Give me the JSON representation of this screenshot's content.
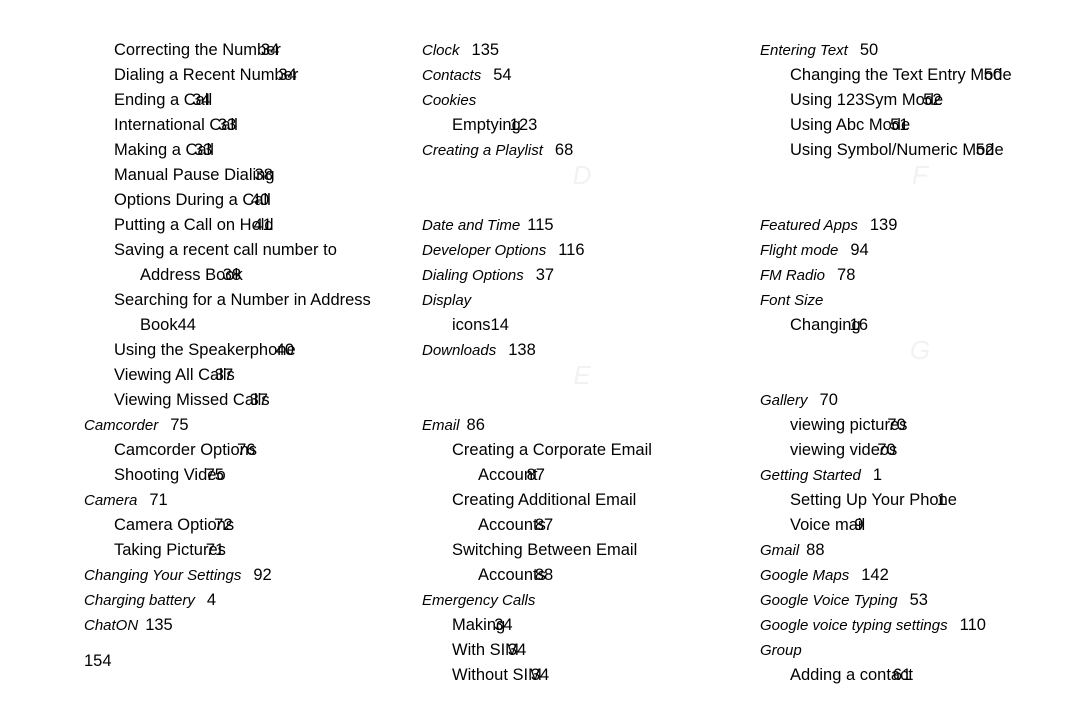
{
  "document": {
    "type": "index-page",
    "folio": "154",
    "background_color": "#ffffff",
    "text_color": "#000000",
    "section_letter_color": "#f2f2f2"
  },
  "columns": [
    {
      "id": "column-1",
      "rows": [
        {
          "kind": "sub",
          "text": "Correcting the Number",
          "page": "34",
          "overlap": "ov2"
        },
        {
          "kind": "sub",
          "text": "Dialing a Recent Number",
          "page": "34",
          "overlap": "ov2"
        },
        {
          "kind": "sub",
          "text": "Ending a Call",
          "page": "34",
          "overlap": "ov2"
        },
        {
          "kind": "sub",
          "text": "International Call",
          "page": "33",
          "overlap": "ov2"
        },
        {
          "kind": "sub",
          "text": "Making a Call",
          "page": "33",
          "overlap": "ov2"
        },
        {
          "kind": "sub",
          "text": "Manual Pause Dialing",
          "page": "38",
          "overlap": "ov2"
        },
        {
          "kind": "sub",
          "text": "Options During a Call",
          "page": "40",
          "overlap": "ov2"
        },
        {
          "kind": "sub",
          "text": "Putting a Call on Hold",
          "page": "41",
          "overlap": "ov2"
        },
        {
          "kind": "sub",
          "text": "Saving a recent call number to",
          "page": "",
          "overlap": "ov0"
        },
        {
          "kind": "sub2",
          "text": "Address Book",
          "page": "38",
          "overlap": "ov2"
        },
        {
          "kind": "sub",
          "text": "Searching for a Number in Address",
          "page": "",
          "overlap": "ov0"
        },
        {
          "kind": "sub2",
          "text": "Book",
          "page": "44",
          "overlap": "ov0"
        },
        {
          "kind": "sub",
          "text": "Using the Speakerphone",
          "page": "40",
          "overlap": "ov2"
        },
        {
          "kind": "sub",
          "text": "Viewing All Calls",
          "page": "37",
          "overlap": "ov2"
        },
        {
          "kind": "sub",
          "text": "Viewing Missed Calls",
          "page": "37",
          "overlap": "ov2"
        },
        {
          "kind": "head",
          "text": "Camcorder",
          "page": "75",
          "overlap": "gap2"
        },
        {
          "kind": "sub",
          "text": "Camcorder Options",
          "page": "76",
          "overlap": "ov2"
        },
        {
          "kind": "sub",
          "text": "Shooting Video",
          "page": "75",
          "overlap": "ov2"
        },
        {
          "kind": "head",
          "text": "Camera",
          "page": "71",
          "overlap": "gap2"
        },
        {
          "kind": "sub",
          "text": "Camera Options",
          "page": "72",
          "overlap": "ov2"
        },
        {
          "kind": "sub",
          "text": "Taking Pictures",
          "page": "71",
          "overlap": "ov2"
        },
        {
          "kind": "head",
          "text": "Changing Your Settings",
          "page": "92",
          "overlap": "gap2"
        },
        {
          "kind": "head",
          "text": "Charging battery",
          "page": "4",
          "overlap": "gap2"
        },
        {
          "kind": "head",
          "text": "ChatON",
          "page": "135",
          "overlap": "gap"
        }
      ]
    },
    {
      "id": "column-2",
      "rows": [
        {
          "kind": "head",
          "text": "Clock",
          "page": "135",
          "overlap": "gap2"
        },
        {
          "kind": "head",
          "text": "Contacts",
          "page": "54",
          "overlap": "gap2"
        },
        {
          "kind": "head",
          "text": "Cookies",
          "page": "",
          "overlap": "ov0"
        },
        {
          "kind": "sub",
          "text": "Emptying",
          "page": "123",
          "overlap": "ov1"
        },
        {
          "kind": "head",
          "text": "Creating a Playlist",
          "page": "68",
          "overlap": "gap2"
        },
        {
          "kind": "letter",
          "text": "D"
        },
        {
          "kind": "spacer"
        },
        {
          "kind": "head",
          "text": "Date and Time",
          "page": "115",
          "overlap": "gap"
        },
        {
          "kind": "head",
          "text": "Developer Options",
          "page": "116",
          "overlap": "gap2"
        },
        {
          "kind": "head",
          "text": "Dialing Options",
          "page": "37",
          "overlap": "gap2"
        },
        {
          "kind": "head",
          "text": "Display",
          "page": "",
          "overlap": "ov0"
        },
        {
          "kind": "sub",
          "text": "icons",
          "page": "14",
          "overlap": "ov0"
        },
        {
          "kind": "head",
          "text": "Downloads",
          "page": "138",
          "overlap": "gap2"
        },
        {
          "kind": "letter",
          "text": "E"
        },
        {
          "kind": "spacer"
        },
        {
          "kind": "head",
          "text": "Email",
          "page": "86",
          "overlap": "gap"
        },
        {
          "kind": "sub",
          "text": "Creating a Corporate Email",
          "page": "",
          "overlap": "ov0"
        },
        {
          "kind": "sub2",
          "text": "Account",
          "page": "87",
          "overlap": "ov1"
        },
        {
          "kind": "sub",
          "text": "Creating Additional Email",
          "page": "",
          "overlap": "ov0"
        },
        {
          "kind": "sub2",
          "text": "Accounts",
          "page": "87",
          "overlap": "ov1"
        },
        {
          "kind": "sub",
          "text": "Switching Between Email",
          "page": "",
          "overlap": "ov0"
        },
        {
          "kind": "sub2",
          "text": "Accounts",
          "page": "88",
          "overlap": "ov1"
        },
        {
          "kind": "head",
          "text": "Emergency Calls",
          "page": "",
          "overlap": "ov0"
        },
        {
          "kind": "sub",
          "text": "Making",
          "page": "34",
          "overlap": "ov1"
        },
        {
          "kind": "sub",
          "text": "With SIM",
          "page": "34",
          "overlap": "ov1"
        },
        {
          "kind": "sub",
          "text": "Without SIM",
          "page": "34",
          "overlap": "ov1"
        }
      ]
    },
    {
      "id": "column-3",
      "rows": [
        {
          "kind": "head",
          "text": "Entering Text",
          "page": "50",
          "overlap": "gap2"
        },
        {
          "kind": "sub",
          "text": "Changing the Text Entry Mode",
          "page": "50",
          "overlap": "ov3"
        },
        {
          "kind": "sub",
          "text": "Using 123Sym Mode",
          "page": "52",
          "overlap": "ov2"
        },
        {
          "kind": "sub",
          "text": "Using Abc Mode",
          "page": "51",
          "overlap": "ov2"
        },
        {
          "kind": "sub",
          "text": "Using Symbol/Numeric Mode",
          "page": "52",
          "overlap": "ov3"
        },
        {
          "kind": "letter",
          "text": "F"
        },
        {
          "kind": "spacer"
        },
        {
          "kind": "head",
          "text": "Featured Apps",
          "page": "139",
          "overlap": "gap2"
        },
        {
          "kind": "head",
          "text": "Flight mode",
          "page": "94",
          "overlap": "gap2"
        },
        {
          "kind": "head",
          "text": "FM Radio",
          "page": "78",
          "overlap": "gap2"
        },
        {
          "kind": "head",
          "text": "Font Size",
          "page": "",
          "overlap": "ov0"
        },
        {
          "kind": "sub",
          "text": "Changing",
          "page": "16",
          "overlap": "ov1"
        },
        {
          "kind": "letter",
          "text": "G"
        },
        {
          "kind": "spacer"
        },
        {
          "kind": "head",
          "text": "Gallery",
          "page": "70",
          "overlap": "gap2"
        },
        {
          "kind": "sub",
          "text": "viewing pictures",
          "page": "70",
          "overlap": "ov2"
        },
        {
          "kind": "sub",
          "text": "viewing videos",
          "page": "70",
          "overlap": "ov2"
        },
        {
          "kind": "head",
          "text": "Getting Started",
          "page": "1",
          "overlap": "gap2"
        },
        {
          "kind": "sub",
          "text": "Setting Up Your Phone",
          "page": "1",
          "overlap": "ov2"
        },
        {
          "kind": "sub",
          "text": "Voice mail",
          "page": "9",
          "overlap": "ov1"
        },
        {
          "kind": "head",
          "text": "Gmail",
          "page": "88",
          "overlap": "gap"
        },
        {
          "kind": "head",
          "text": "Google Maps",
          "page": "142",
          "overlap": "gap2"
        },
        {
          "kind": "head",
          "text": "Google Voice Typing",
          "page": "53",
          "overlap": "gap2"
        },
        {
          "kind": "head",
          "text": "Google voice typing settings",
          "page": "110",
          "overlap": "gap2"
        },
        {
          "kind": "head",
          "text": "Group",
          "page": "",
          "overlap": "ov0"
        },
        {
          "kind": "sub",
          "text": "Adding a contact",
          "page": "61",
          "overlap": "ov2"
        }
      ]
    }
  ]
}
